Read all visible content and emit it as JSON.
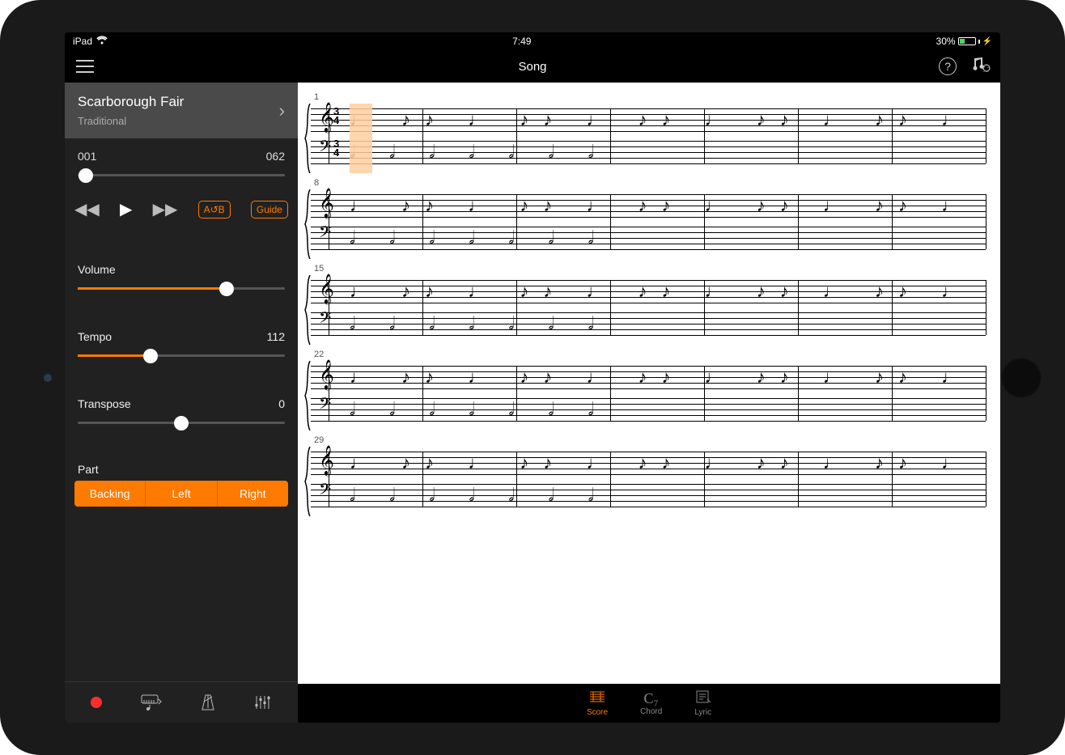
{
  "status_bar": {
    "device": "iPad",
    "time": "7:49",
    "battery_pct": "30%"
  },
  "header": {
    "title": "Song"
  },
  "song": {
    "title": "Scarborough Fair",
    "subtitle": "Traditional"
  },
  "position": {
    "current": "001",
    "total": "062",
    "progress_pct": 4
  },
  "transport": {
    "ab_label": "A↺B",
    "guide_label": "Guide"
  },
  "volume": {
    "label": "Volume",
    "value_pct": 72
  },
  "tempo": {
    "label": "Tempo",
    "value": "112",
    "value_pct": 35
  },
  "transpose": {
    "label": "Transpose",
    "value": "0",
    "value_pct": 50
  },
  "part": {
    "label": "Part",
    "options": [
      "Backing",
      "Left",
      "Right"
    ]
  },
  "tabs": {
    "score": "Score",
    "chord": "Chord",
    "lyric": "Lyric",
    "chord_symbol": "C₇"
  },
  "score": {
    "systems": [
      1,
      8,
      15,
      22,
      29
    ],
    "time_sig_top": "3",
    "time_sig_bottom": "4"
  },
  "colors": {
    "accent": "#ff7a00"
  }
}
